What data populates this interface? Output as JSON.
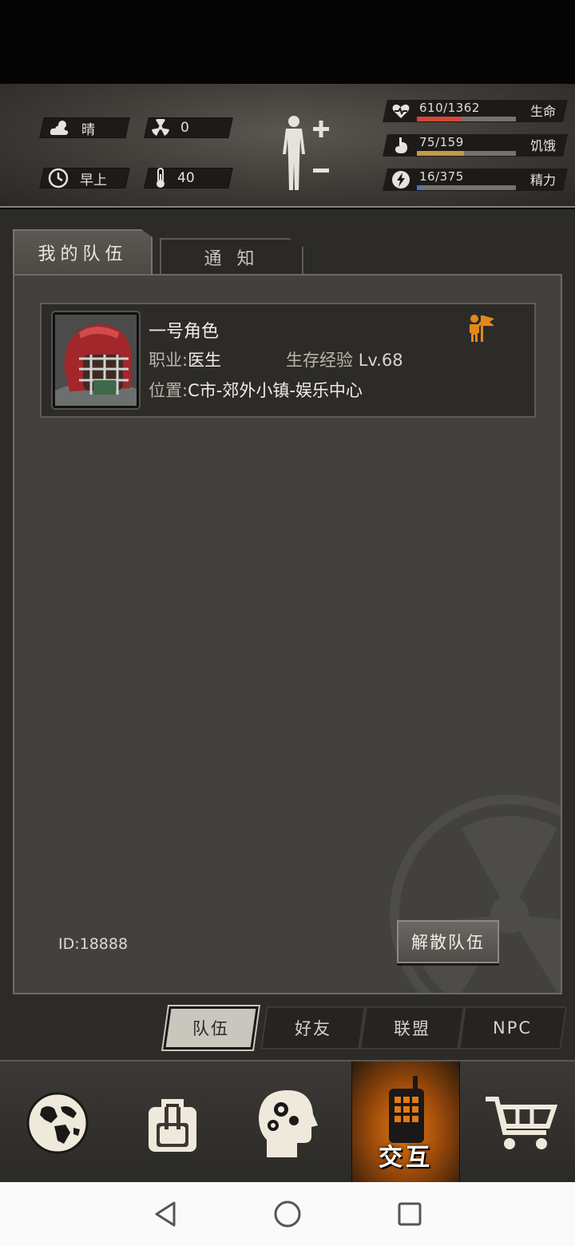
{
  "hud": {
    "weather_label": "晴",
    "radiation_value": "0",
    "time_label": "早上",
    "temperature_value": "40",
    "stats": [
      {
        "name": "health",
        "value": "610/1362",
        "label": "生命",
        "fraction": 0.448,
        "color": "#d0473a"
      },
      {
        "name": "hunger",
        "value": "75/159",
        "label": "饥饿",
        "fraction": 0.472,
        "color": "#c59a45"
      },
      {
        "name": "energy",
        "value": "16/375",
        "label": "精力",
        "fraction": 0.043,
        "color": "#3b78d1"
      }
    ]
  },
  "tabs": {
    "my_team": "我的队伍",
    "notice": "通 知"
  },
  "member": {
    "name": "一号角色",
    "job_label": "职业:",
    "job_value": "医生",
    "exp_label": "生存经验",
    "exp_value": "Lv.68",
    "location_label": "位置:",
    "location_value": "C市-郊外小镇-娱乐中心"
  },
  "team_id": "ID:18888",
  "disband_label": "解散队伍",
  "subtabs": [
    "队伍",
    "好友",
    "联盟",
    "NPC"
  ],
  "bottom_nav": {
    "interact_label": "交互"
  },
  "icons": {
    "weather": "partly-cloudy-icon",
    "radiation": "radiation-icon",
    "time": "clock-icon",
    "temperature": "thermometer-icon",
    "body": "body-figure-icon",
    "health": "heart-icon",
    "hunger": "stomach-icon",
    "energy": "lightning-icon",
    "leader": "flag-icon",
    "map": "globe-icon",
    "inventory": "backpack-icon",
    "skills": "head-gears-icon",
    "interact": "walkie-talkie-icon",
    "shop": "cart-icon"
  }
}
